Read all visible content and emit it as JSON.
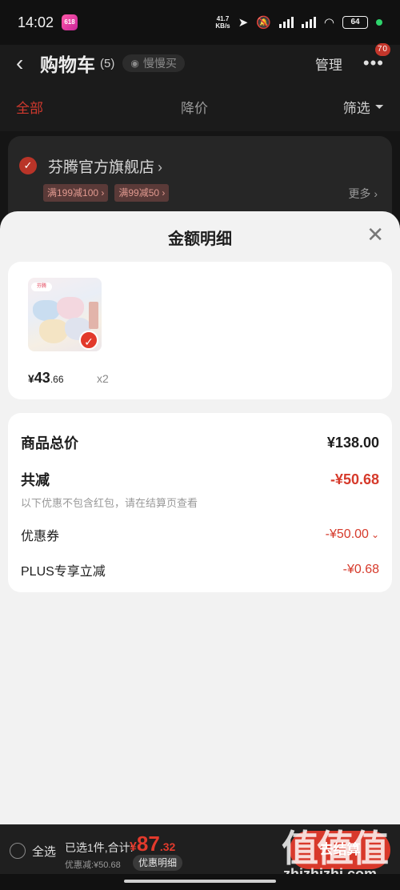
{
  "status_bar": {
    "time": "14:02",
    "app_badge": "618",
    "net_speed_value": "41.7",
    "net_speed_unit": "KB/s",
    "hd_label": "HD",
    "battery": "64"
  },
  "cart": {
    "title": "购物车",
    "count": "(5)",
    "slow_buy": "慢慢买",
    "manage": "管理",
    "more_badge": "70",
    "tabs": {
      "all": "全部",
      "price_drop": "降价",
      "filter": "筛选"
    },
    "store": {
      "name": "芬腾官方旗舰店",
      "promos": [
        "满199减100 ›",
        "满99减50 ›"
      ],
      "more": "更多 ›"
    }
  },
  "sheet": {
    "title": "金额明细",
    "goods": {
      "thumb_logo": "芬腾",
      "price_currency": "¥",
      "price_int": "43",
      "price_dec": ".66",
      "qty": "x2"
    },
    "summary": {
      "total_label": "商品总价",
      "total_value": "¥138.00",
      "reduce_label": "共减",
      "reduce_value": "-¥50.68",
      "note": "以下优惠不包含红包，请在结算页查看",
      "coupon_label": "优惠券",
      "coupon_value": "-¥50.00",
      "plus_label": "PLUS专享立减",
      "plus_value": "-¥0.68"
    }
  },
  "checkout": {
    "select_all": "全选",
    "selected_info": "已选1件,合计:",
    "total_currency": "¥",
    "total_int": "87",
    "total_dec": ".32",
    "discount": "优惠减:¥50.68",
    "detail": "优惠明细",
    "button": "去结算"
  },
  "watermark": {
    "logo": "值值值",
    "text": "zhizhizhi.com"
  },
  "colors": {
    "accent": "#d8392b",
    "sheet_bg": "#f2f2f2",
    "page_bg": "#151515"
  }
}
